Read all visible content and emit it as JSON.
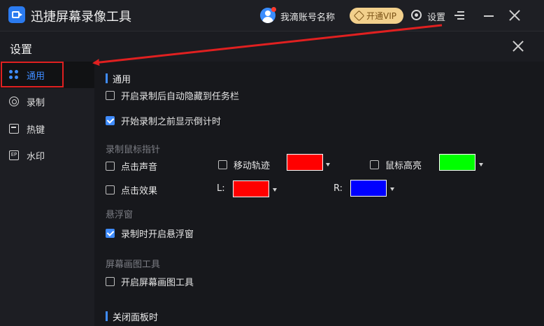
{
  "app": {
    "title": "迅捷屏幕录像工具"
  },
  "header": {
    "user_name": "我滴账号名称",
    "vip_label": "开通VIP",
    "settings_label": "设置"
  },
  "dialog": {
    "title": "设置"
  },
  "sidebar": {
    "items": [
      {
        "label": "通用",
        "icon": "grid-icon",
        "active": true
      },
      {
        "label": "录制",
        "icon": "record-icon"
      },
      {
        "label": "热键",
        "icon": "hotkey-icon"
      },
      {
        "label": "水印",
        "icon": "watermark-icon"
      }
    ]
  },
  "general": {
    "section_title": "通用",
    "auto_hide_label": "开启录制后自动隐藏到任务栏",
    "auto_hide_checked": false,
    "countdown_label": "开始录制之前显示倒计时",
    "countdown_checked": true
  },
  "mouse": {
    "group_label": "录制鼠标指针",
    "click_sound_label": "点击声音",
    "click_sound_checked": false,
    "trail_label": "移动轨迹",
    "trail_checked": false,
    "trail_color": "#ff0000",
    "highlight_label": "鼠标高亮",
    "highlight_checked": false,
    "highlight_color": "#00ff00",
    "click_effect_label": "点击效果",
    "click_effect_checked": false,
    "left_label": "L:",
    "left_color": "#ff0000",
    "right_label": "R:",
    "right_color": "#0000ff"
  },
  "floating": {
    "group_label": "悬浮窗",
    "open_label": "录制时开启悬浮窗",
    "open_checked": true
  },
  "draw_tool": {
    "group_label": "屏幕画图工具",
    "open_label": "开启屏幕画图工具",
    "open_checked": false
  },
  "close_panel": {
    "section_title": "关闭面板时"
  },
  "colors": {
    "accent": "#3f8cff",
    "annotation": "#e02020"
  }
}
